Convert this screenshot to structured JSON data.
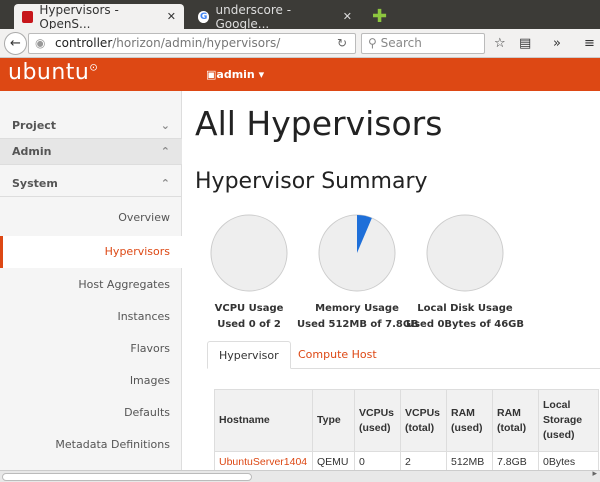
{
  "browser": {
    "tabs": [
      {
        "title": "Hypervisors - OpenS...",
        "active": true
      },
      {
        "title": "underscore - Google...",
        "active": false
      }
    ],
    "url_host": "controller",
    "url_path": "/horizon/admin/hypervisors/",
    "search_placeholder": "Search"
  },
  "header": {
    "logo": "ubuntu",
    "user_menu": "admin",
    "brand_color": "#dd4814"
  },
  "sidebar": {
    "sections": [
      {
        "label": "Project"
      },
      {
        "label": "Admin"
      },
      {
        "label": "System"
      }
    ],
    "items": [
      {
        "label": "Overview"
      },
      {
        "label": "Hypervisors",
        "active": true
      },
      {
        "label": "Host Aggregates"
      },
      {
        "label": "Instances"
      },
      {
        "label": "Flavors"
      },
      {
        "label": "Images"
      },
      {
        "label": "Defaults"
      },
      {
        "label": "Metadata Definitions"
      }
    ]
  },
  "main": {
    "title": "All Hypervisors",
    "summary_title": "Hypervisor Summary",
    "pies": [
      {
        "label": "VCPU Usage",
        "detail": "Used 0 of 2",
        "fraction": 0
      },
      {
        "label": "Memory Usage",
        "detail": "Used 512MB of 7.8GB",
        "fraction": 0.064
      },
      {
        "label": "Local Disk Usage",
        "detail": "Used 0Bytes of 46GB",
        "fraction": 0
      }
    ],
    "tabs": [
      {
        "label": "Hypervisor",
        "active": true
      },
      {
        "label": "Compute Host"
      }
    ],
    "table": {
      "headers": [
        "Hostname",
        "Type",
        "VCPUs (used)",
        "VCPUs (total)",
        "RAM (used)",
        "RAM (total)",
        "Local Storage (used)"
      ],
      "rows": [
        [
          "UbuntuServer1404",
          "QEMU",
          "0",
          "2",
          "512MB",
          "7.8GB",
          "0Bytes"
        ]
      ]
    }
  }
}
